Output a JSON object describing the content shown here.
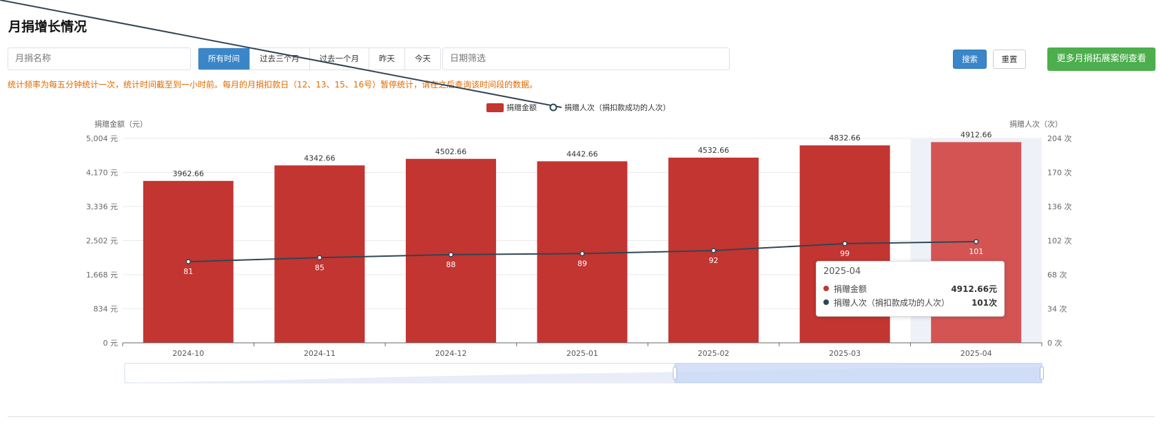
{
  "page": {
    "title": "月捐增长情况"
  },
  "filters": {
    "name_placeholder": "月捐名称",
    "ranges": [
      {
        "label": "所有时间",
        "active": true
      },
      {
        "label": "过去三个月",
        "active": false
      },
      {
        "label": "过去一个月",
        "active": false
      },
      {
        "label": "昨天",
        "active": false
      },
      {
        "label": "今天",
        "active": false
      }
    ],
    "date_placeholder": "日期筛选",
    "search_label": "搜索",
    "reset_label": "重置",
    "more_label": "更多月捐拓展案例查看"
  },
  "notice": "统计频率为每五分钟统计一次，统计时间截至到一小时前。每月的月捐扣款日（12、13、15、16号）暂停统计，请在之后查询该时间段的数据。",
  "colors": {
    "bar": "#c23531",
    "bar_highlight": "#d45454",
    "line": "#2f4554",
    "accent_blue": "#3a86c8",
    "accent_green": "#4cae4c",
    "notice": "#e06a00"
  },
  "chart_data": {
    "type": "bar",
    "legend": {
      "position": "top-center",
      "items": [
        "捐赠金额",
        "捐赠人次（捐扣款成功的人次）"
      ]
    },
    "y_left": {
      "label": "捐赠金额（元）",
      "range": [
        0,
        5004
      ],
      "ticks": [
        "0 元",
        "834 元",
        "1,668 元",
        "2,502 元",
        "3,336 元",
        "4,170 元",
        "5,004 元"
      ]
    },
    "y_right": {
      "label": "捐赠人次（次）",
      "range": [
        0,
        204
      ],
      "ticks": [
        "0 次",
        "34 次",
        "68 次",
        "102 次",
        "136 次",
        "170 次",
        "204 次"
      ]
    },
    "categories": [
      "2024-10",
      "2024-11",
      "2024-12",
      "2025-01",
      "2025-02",
      "2025-03",
      "2025-04"
    ],
    "series": [
      {
        "name": "捐赠金额",
        "type": "bar",
        "axis": "left",
        "values": [
          3962.66,
          4342.66,
          4502.66,
          4442.66,
          4532.66,
          4832.66,
          4912.66
        ],
        "labels": [
          "3962.66",
          "4342.66",
          "4502.66",
          "4442.66",
          "4532.66",
          "4832.66",
          "4912.66"
        ]
      },
      {
        "name": "捐赠人次（捐扣款成功的人次）",
        "type": "line",
        "axis": "right",
        "values": [
          81,
          85,
          88,
          89,
          92,
          99,
          101
        ],
        "labels": [
          "81",
          "85",
          "88",
          "89",
          "92",
          "99",
          "101"
        ]
      }
    ],
    "highlight_index": 6,
    "zoom_window": [
      0.6,
      1.0
    ],
    "grid": true
  },
  "tooltip": {
    "title": "2025-04",
    "rows": [
      {
        "name": "捐赠金额",
        "value": "4912.66元",
        "color": "#c23531"
      },
      {
        "name": "捐赠人次（捐扣款成功的人次）",
        "value": "101次",
        "color": "#2f4554"
      }
    ]
  }
}
